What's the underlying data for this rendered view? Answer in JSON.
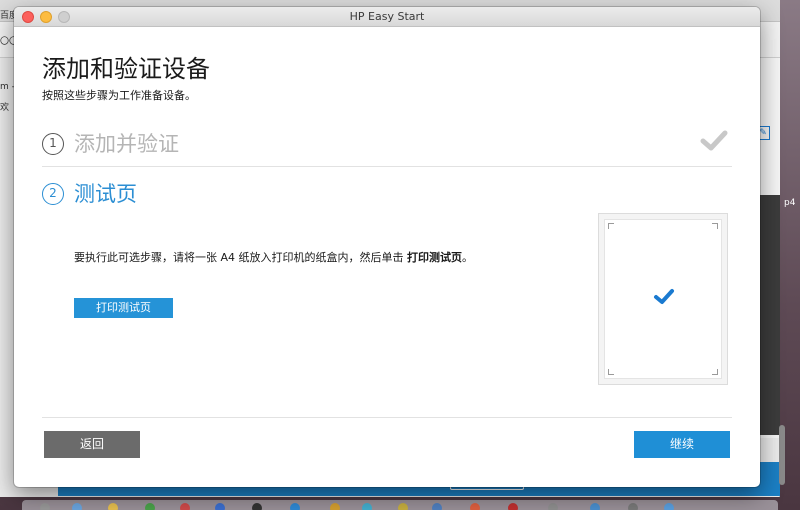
{
  "window": {
    "title": "HP Easy Start"
  },
  "page": {
    "title": "添加和验证设备",
    "subtitle": "按照这些步骤为工作准备设备。"
  },
  "steps": [
    {
      "number": "1",
      "label": "添加并验证",
      "state": "completed"
    },
    {
      "number": "2",
      "label": "测试页",
      "state": "active"
    }
  ],
  "instruction": {
    "text_before": "要执行此可选步骤，请将一张 A4 纸放入打印机的纸盒内，然后单击 ",
    "action_bold": "打印测试页",
    "text_after": "。"
  },
  "buttons": {
    "print_test_page": "打印测试页",
    "back": "返回",
    "continue": "继续"
  },
  "background": {
    "left_texts": [
      "百度",
      "〇〇",
      "m -",
      "欢"
    ],
    "side_label": "p4"
  },
  "colors": {
    "accent": "#2b8ed3",
    "primary_button": "#1f8fd6",
    "secondary_button": "#6b6b6b",
    "completed_text": "#b5b5b5",
    "check_gray": "#c8c8c8",
    "paper_check": "#1a7ad0"
  },
  "icons": {
    "step1_status": "checkmark-icon",
    "paper_status": "checkmark-icon"
  }
}
